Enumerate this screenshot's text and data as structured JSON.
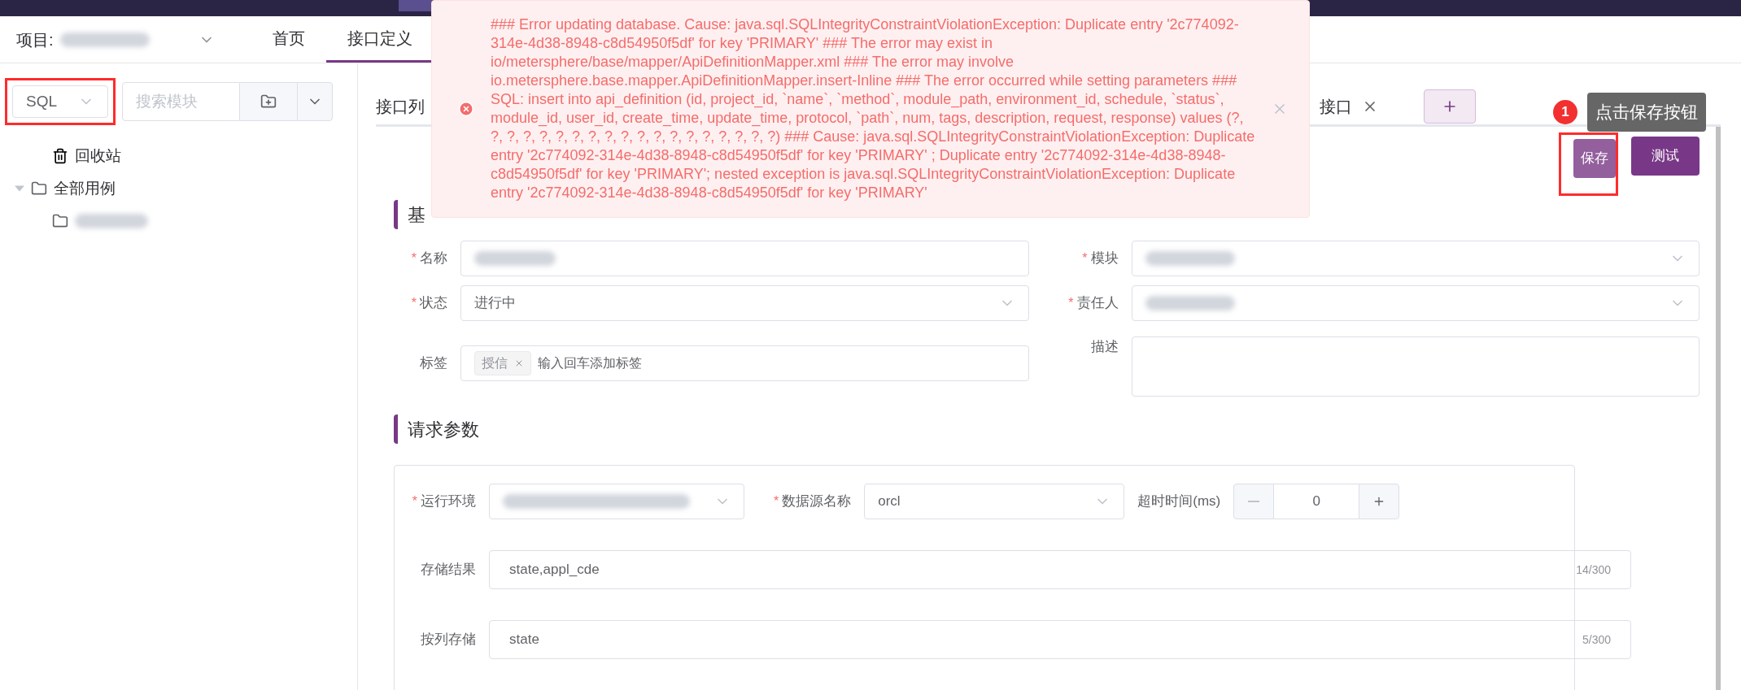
{
  "header": {
    "project_label": "项目:",
    "nav": [
      {
        "label": "首页",
        "selected": false
      },
      {
        "label": "接口定义",
        "selected": true
      }
    ]
  },
  "sidebar": {
    "protocol_select": {
      "value": "SQL",
      "highlighted": true
    },
    "search": {
      "placeholder": "搜索模块"
    },
    "tree": [
      {
        "label": "回收站",
        "kind": "trash"
      },
      {
        "label": "全部用例",
        "kind": "folder",
        "expanded": true,
        "children": [
          {
            "kind": "folder"
          }
        ]
      }
    ]
  },
  "tabs": [
    {
      "label": "接口列"
    },
    {
      "label": "接口",
      "closable": true
    }
  ],
  "toast": {
    "message": "### Error updating database. Cause: java.sql.SQLIntegrityConstraintViolationException: Duplicate entry '2c774092-314e-4d38-8948-c8d54950f5df' for key 'PRIMARY' ### The error may exist in io/metersphere/base/mapper/ApiDefinitionMapper.xml ### The error may involve io.metersphere.base.mapper.ApiDefinitionMapper.insert-Inline ### The error occurred while setting parameters ### SQL: insert into api_definition (id, project_id, `name`, `method`, module_path, environment_id, schedule, `status`, module_id, user_id, create_time, update_time, protocol, `path`, num, tags, description, request, response) values (?, ?, ?, ?, ?, ?, ?, ?, ?, ?, ?, ?, ?, ?, ?, ?, ?, ?, ?) ### Cause: java.sql.SQLIntegrityConstraintViolationException: Duplicate entry '2c774092-314e-4d38-8948-c8d54950f5df' for key 'PRIMARY' ; Duplicate entry '2c774092-314e-4d38-8948-c8d54950f5df' for key 'PRIMARY'; nested exception is java.sql.SQLIntegrityConstraintViolationException: Duplicate entry '2c774092-314e-4d38-8948-c8d54950f5df' for key 'PRIMARY'"
  },
  "guide": {
    "step": "1",
    "tip": "点击保存按钮"
  },
  "actions": [
    {
      "label": "保存",
      "kind": "save",
      "highlighted": true
    },
    {
      "label": "测试",
      "kind": "test",
      "highlighted": false
    }
  ],
  "basic_info": {
    "title": "基",
    "fields": [
      {
        "label": "名称",
        "required_mark": "*",
        "kind": "input"
      },
      {
        "label": "模块",
        "required_mark": "*",
        "kind": "select"
      },
      {
        "label": "状态",
        "required_mark": "*",
        "kind": "select",
        "value": "进行中"
      },
      {
        "label": "责任人",
        "required_mark": "*",
        "kind": "select"
      },
      {
        "label": "标签",
        "kind": "tags",
        "tags": [
          "授信"
        ],
        "placeholder": "输入回车添加标签"
      },
      {
        "label": "描述",
        "kind": "textarea"
      }
    ]
  },
  "request_params": {
    "title": "请求参数",
    "environment": {
      "label": "运行环境",
      "required_mark": "*"
    },
    "datasource": {
      "label": "数据源名称",
      "required_mark": "*",
      "value": "orcl"
    },
    "timeout": {
      "label": "超时时间(ms)",
      "value": "0"
    },
    "rows": [
      {
        "label": "存储结果",
        "value": "state,appl_cde",
        "count": "14/300"
      },
      {
        "label": "按列存储",
        "value": "state",
        "count": "5/300"
      }
    ]
  }
}
